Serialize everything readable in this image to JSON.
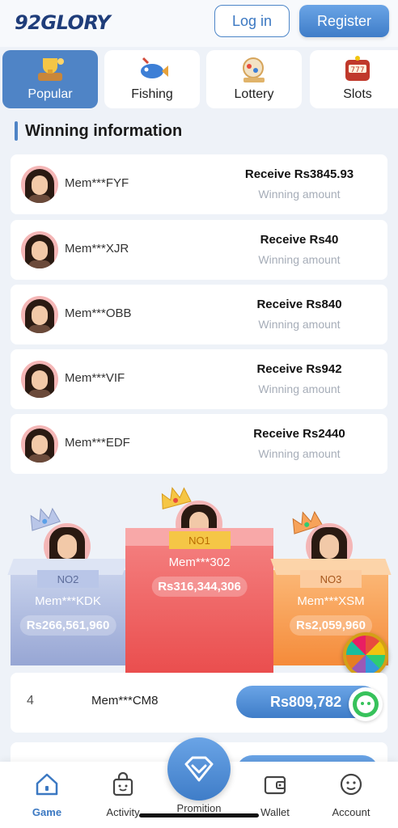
{
  "header": {
    "logo": "92GLORY",
    "login_label": "Log in",
    "register_label": "Register"
  },
  "tabs": [
    {
      "label": "Popular",
      "icon": "trophy-icon",
      "active": true
    },
    {
      "label": "Fishing",
      "icon": "fishing-icon",
      "active": false
    },
    {
      "label": "Lottery",
      "icon": "lottery-icon",
      "active": false
    },
    {
      "label": "Slots",
      "icon": "slots-icon",
      "active": false
    }
  ],
  "section": {
    "title": "Winning information"
  },
  "winners": [
    {
      "name": "Mem***FYF",
      "amount": "Receive Rs3845.93",
      "sub": "Winning amount"
    },
    {
      "name": "Mem***XJR",
      "amount": "Receive Rs40",
      "sub": "Winning amount"
    },
    {
      "name": "Mem***OBB",
      "amount": "Receive Rs840",
      "sub": "Winning amount"
    },
    {
      "name": "Mem***VIF",
      "amount": "Receive Rs942",
      "sub": "Winning amount"
    },
    {
      "name": "Mem***EDF",
      "amount": "Receive Rs2440",
      "sub": "Winning amount"
    }
  ],
  "podium": {
    "first": {
      "rank": "NO1",
      "name": "Mem***302",
      "amount": "Rs316,344,306"
    },
    "second": {
      "rank": "NO2",
      "name": "Mem***KDK",
      "amount": "Rs266,561,960"
    },
    "third": {
      "rank": "NO3",
      "name": "Mem***XSM",
      "amount": "Rs2,059,960"
    }
  },
  "ranking": [
    {
      "num": "4",
      "name": "Mem***CM8",
      "amount": "Rs809,782"
    }
  ],
  "nav": {
    "game": "Game",
    "activity": "Activity",
    "promotion": "Promition",
    "wallet": "Wallet",
    "account": "Account"
  },
  "colors": {
    "accent": "#4f84c6",
    "first_place": "#ea4e4e",
    "second_place": "#97a6d4",
    "third_place": "#f58b3a"
  }
}
